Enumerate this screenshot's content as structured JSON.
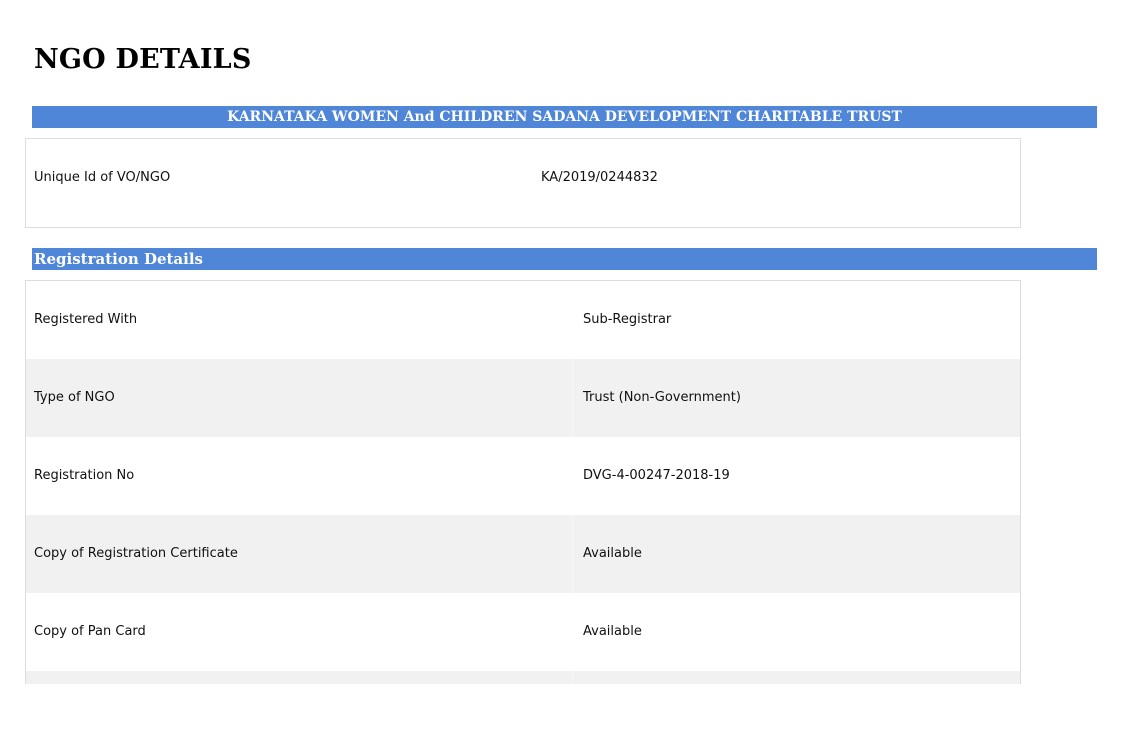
{
  "page": {
    "title": "NGO DETAILS"
  },
  "organization": {
    "name": "KARNATAKA WOMEN And CHILDREN SADANA DEVELOPMENT CHARITABLE TRUST",
    "unique_id_label": "Unique Id of VO/NGO",
    "unique_id_value": "KA/2019/0244832"
  },
  "registration": {
    "section_title": "Registration Details",
    "rows": [
      {
        "label": "Registered With",
        "value": "Sub-Registrar"
      },
      {
        "label": "Type of NGO",
        "value": "Trust (Non-Government)"
      },
      {
        "label": "Registration No",
        "value": "DVG-4-00247-2018-19"
      },
      {
        "label": "Copy of Registration Certificate",
        "value": "Available"
      },
      {
        "label": "Copy of Pan Card",
        "value": "Available"
      },
      {
        "label": "",
        "value": ""
      }
    ]
  },
  "colors": {
    "banner": "#4f86d8",
    "row_shade": "#f1f1f1",
    "border": "#dddddd"
  }
}
